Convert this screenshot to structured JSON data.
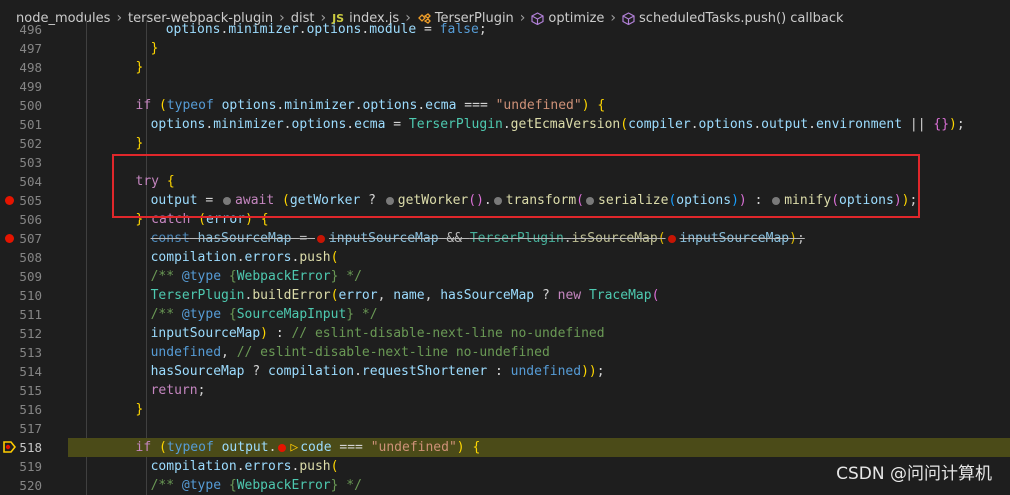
{
  "breadcrumb": {
    "items": [
      "node_modules",
      "terser-webpack-plugin",
      "dist",
      "index.js",
      "TerserPlugin",
      "optimize",
      "scheduledTasks.push() callback"
    ],
    "icons": [
      "",
      "",
      "",
      "js-file-icon",
      "class-icon",
      "method-icon",
      "method-icon"
    ]
  },
  "colors": {
    "keyword": "#c586c0",
    "storage": "#569cd6",
    "variable": "#9cdcfe",
    "function": "#dcdcaa",
    "class": "#4ec9b0",
    "string": "#ce9178",
    "comment": "#6a9955",
    "brace": "#ffd700",
    "brace2": "#da70d6",
    "brace3": "#179fff",
    "plain": "#d4d4d4",
    "breakpoint": "#e51400",
    "highlight_box": "#e0272b"
  },
  "lines": [
    {
      "n": "496",
      "code": "options.minimizer.options.module = false;"
    },
    {
      "n": "497",
      "code": "}"
    },
    {
      "n": "498",
      "code": "}"
    },
    {
      "n": "499",
      "code": ""
    },
    {
      "n": "500",
      "code": "if (typeof options.minimizer.options.ecma === \"undefined\") {"
    },
    {
      "n": "501",
      "code": "options.minimizer.options.ecma = TerserPlugin.getEcmaVersion(compiler.options.output.environment || {});"
    },
    {
      "n": "502",
      "code": "}"
    },
    {
      "n": "503",
      "code": ""
    },
    {
      "n": "504",
      "code": "try {"
    },
    {
      "n": "505",
      "code": "output = await (getWorker ? getWorker().transform(serialize(options)) : minify(options));"
    },
    {
      "n": "506",
      "code": "} catch (error) {"
    },
    {
      "n": "507",
      "code": "const hasSourceMap = inputSourceMap && TerserPlugin.isSourceMap(inputSourceMap);"
    },
    {
      "n": "508",
      "code": "compilation.errors.push("
    },
    {
      "n": "509",
      "code": "/** @type {WebpackError} */"
    },
    {
      "n": "510",
      "code": "TerserPlugin.buildError(error, name, hasSourceMap ? new TraceMap("
    },
    {
      "n": "511",
      "code": "/** @type {SourceMapInput} */"
    },
    {
      "n": "512",
      "code": "inputSourceMap) : // eslint-disable-next-line no-undefined"
    },
    {
      "n": "513",
      "code": "undefined, // eslint-disable-next-line no-undefined"
    },
    {
      "n": "514",
      "code": "hasSourceMap ? compilation.requestShortener : undefined));"
    },
    {
      "n": "515",
      "code": "return;"
    },
    {
      "n": "516",
      "code": "}"
    },
    {
      "n": "517",
      "code": ""
    },
    {
      "n": "518",
      "code": "if (typeof output.code === \"undefined\") {"
    },
    {
      "n": "519",
      "code": "compilation.errors.push("
    },
    {
      "n": "520",
      "code": "/** @type {WebpackError} */"
    }
  ],
  "breakpoints": [
    "505",
    "507"
  ],
  "current_line": "518",
  "watermark": "CSDN @问问计算机"
}
